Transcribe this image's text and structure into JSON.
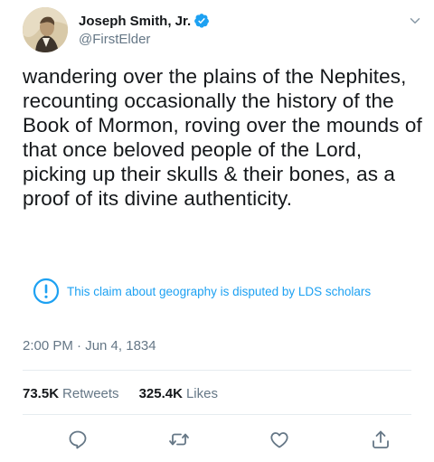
{
  "author": {
    "display_name": "Joseph Smith, Jr.",
    "handle": "@FirstElder",
    "avatar_icon": "portrait-avatar",
    "verified_icon": "verified-badge-icon"
  },
  "tweet": {
    "text": "wandering over the plains of the Nephites, recounting occasionally the history of the Book of Mormon, roving over the mounds of that once beloved people of the Lord, picking up their skulls & their bones, as a proof of its divine authenticity.",
    "timestamp": "2:00 PM · Jun 4, 1834"
  },
  "notice": {
    "icon": "exclamation-circle-icon",
    "text": "This claim about geography is disputed by LDS scholars"
  },
  "stats": {
    "retweets_count": "73.5K",
    "retweets_label": "Retweets",
    "likes_count": "325.4K",
    "likes_label": "Likes"
  },
  "actions": [
    "reply-icon",
    "retweet-icon",
    "like-icon",
    "share-icon"
  ],
  "colors": {
    "accent": "#1da1f2",
    "text": "#14171a",
    "secondary_text": "#657786",
    "divider": "#e6ecf0"
  }
}
